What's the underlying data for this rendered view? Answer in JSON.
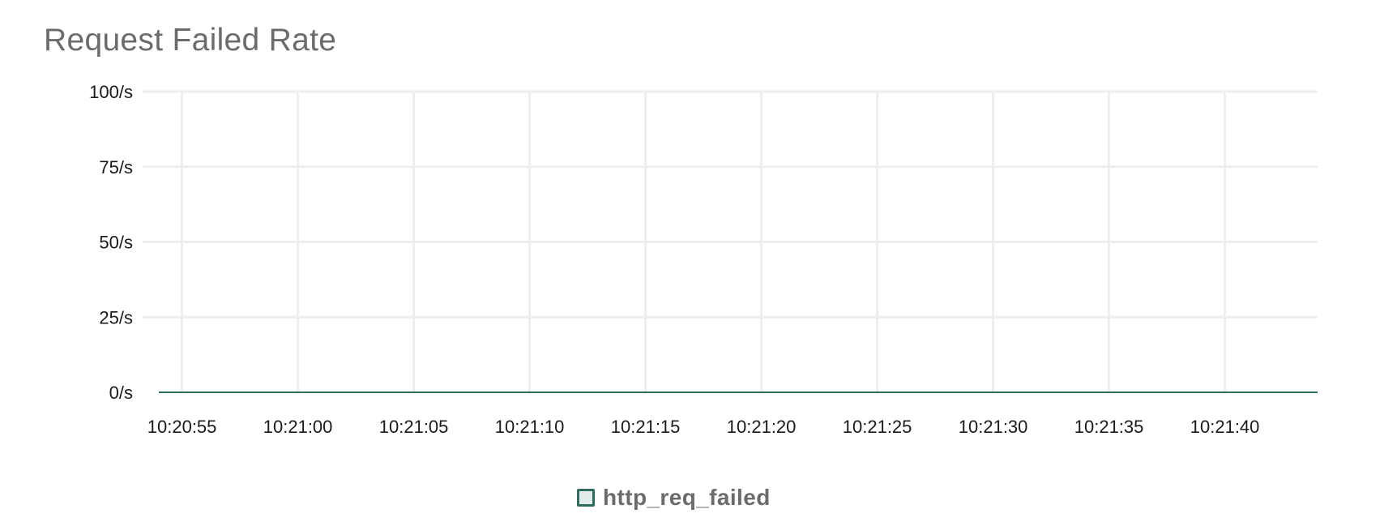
{
  "panel": {
    "title": "Request Failed Rate"
  },
  "chart_data": {
    "type": "line",
    "title": "Request Failed Rate",
    "xlabel": "",
    "ylabel": "",
    "ylim": [
      0,
      100
    ],
    "y_ticks": [
      "0/s",
      "25/s",
      "50/s",
      "75/s",
      "100/s"
    ],
    "y_tick_values": [
      0,
      25,
      50,
      75,
      100
    ],
    "x_ticks": [
      "10:20:55",
      "10:21:00",
      "10:21:05",
      "10:21:10",
      "10:21:15",
      "10:21:20",
      "10:21:25",
      "10:21:30",
      "10:21:35",
      "10:21:40"
    ],
    "x_range": [
      "10:20:54",
      "10:21:44"
    ],
    "grid": true,
    "legend_position": "bottom-center",
    "series": [
      {
        "name": "http_req_failed",
        "color": "#2f6b5e",
        "x": [
          "10:20:54",
          "10:21:44"
        ],
        "values": [
          0,
          0
        ]
      }
    ]
  },
  "legend": {
    "items": [
      {
        "label": "http_req_failed",
        "color": "#2f6b5e"
      }
    ]
  }
}
